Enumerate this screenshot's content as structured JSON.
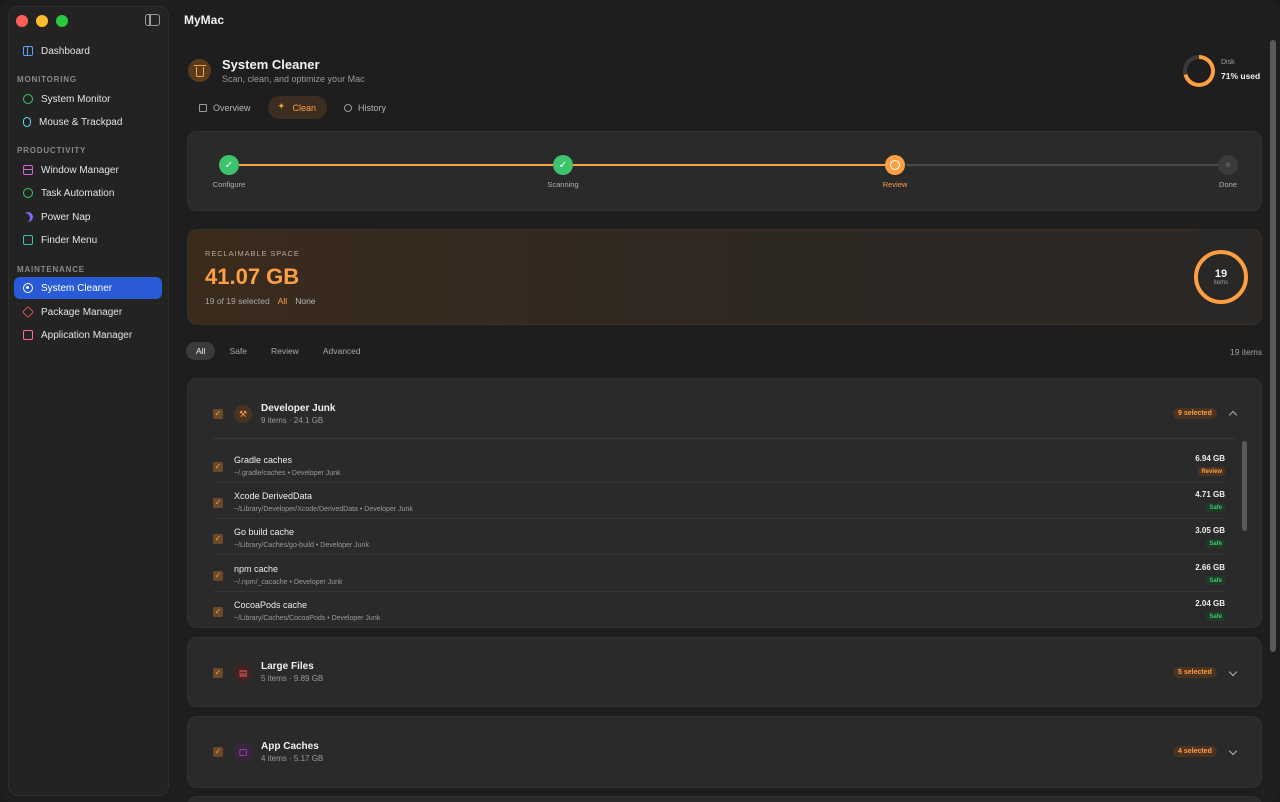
{
  "window": {
    "title": "MyMac"
  },
  "sidebar": {
    "top_item": {
      "label": "Dashboard",
      "icon": "grid-icon"
    },
    "sections": [
      {
        "title": "MONITORING",
        "items": [
          {
            "label": "System Monitor",
            "icon": "gauge-icon"
          },
          {
            "label": "Mouse & Trackpad",
            "icon": "mouse-icon"
          }
        ]
      },
      {
        "title": "PRODUCTIVITY",
        "items": [
          {
            "label": "Window Manager",
            "icon": "window-icon"
          },
          {
            "label": "Task Automation",
            "icon": "clock-icon"
          },
          {
            "label": "Power Nap",
            "icon": "moon-icon"
          },
          {
            "label": "Finder Menu",
            "icon": "finder-icon"
          }
        ]
      },
      {
        "title": "MAINTENANCE",
        "items": [
          {
            "label": "System Cleaner",
            "icon": "cleaner-icon",
            "active": true
          },
          {
            "label": "Package Manager",
            "icon": "box-icon"
          },
          {
            "label": "Application Manager",
            "icon": "app-icon"
          }
        ]
      }
    ]
  },
  "header": {
    "title": "System Cleaner",
    "subtitle": "Scan, clean, and optimize your Mac",
    "disk_label": "Disk",
    "disk_value": "71% used",
    "disk_fraction": 0.71
  },
  "tabs": [
    {
      "label": "Overview",
      "icon": "grid-icon"
    },
    {
      "label": "Clean",
      "icon": "sparkle-icon",
      "active": true
    },
    {
      "label": "History",
      "icon": "history-icon"
    }
  ],
  "stepper": {
    "steps": [
      {
        "label": "Configure",
        "state": "done"
      },
      {
        "label": "Scanning",
        "state": "done"
      },
      {
        "label": "Review",
        "state": "current"
      },
      {
        "label": "Done",
        "state": "todo"
      }
    ]
  },
  "reclaim": {
    "label": "RECLAIMABLE SPACE",
    "value": "41.07 GB",
    "selected_text": "19 of 19 selected",
    "all_label": "All",
    "none_label": "None",
    "ring_count": "19",
    "ring_label": "items"
  },
  "filters": {
    "chips": [
      "All",
      "Safe",
      "Review",
      "Advanced"
    ],
    "active": "All",
    "count_text": "19 items"
  },
  "groups": [
    {
      "title": "Developer Junk",
      "subtitle": "9 items · 24.1 GB",
      "badge": "9 selected",
      "icon": "hammer-icon",
      "expanded": true,
      "rows": [
        {
          "name": "Gradle caches",
          "path": "~/.gradle/caches • Developer Junk",
          "size": "6.94 GB",
          "tag": "Review"
        },
        {
          "name": "Xcode DerivedData",
          "path": "~/Library/Developer/Xcode/DerivedData • Developer Junk",
          "size": "4.71 GB",
          "tag": "Safe"
        },
        {
          "name": "Go build cache",
          "path": "~/Library/Caches/go-build • Developer Junk",
          "size": "3.05 GB",
          "tag": "Safe"
        },
        {
          "name": "npm cache",
          "path": "~/.npm/_cacache • Developer Junk",
          "size": "2.66 GB",
          "tag": "Safe"
        },
        {
          "name": "CocoaPods cache",
          "path": "~/Library/Caches/CocoaPods • Developer Junk",
          "size": "2.04 GB",
          "tag": "Safe"
        }
      ]
    },
    {
      "title": "Large Files",
      "subtitle": "5 items · 9.89 GB",
      "badge": "5 selected",
      "icon": "file-icon",
      "expanded": false
    },
    {
      "title": "App Caches",
      "subtitle": "4 items · 5.17 GB",
      "badge": "4 selected",
      "icon": "app-cache-icon",
      "expanded": false
    }
  ]
}
